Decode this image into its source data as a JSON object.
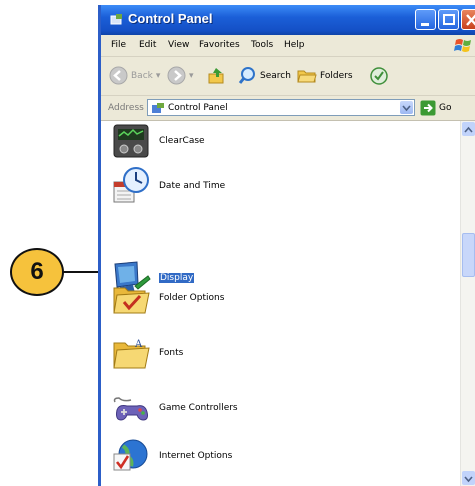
{
  "callout": {
    "number": "6"
  },
  "window": {
    "title": "Control Panel",
    "menu": [
      "File",
      "Edit",
      "View",
      "Favorites",
      "Tools",
      "Help"
    ],
    "toolbar": {
      "back_label": "Back",
      "search_label": "Search",
      "folders_label": "Folders"
    },
    "address": {
      "label": "Address",
      "value": "Control Panel",
      "go_label": "Go"
    }
  },
  "items": [
    {
      "label": "ClearCase",
      "icon": "clearcase-icon"
    },
    {
      "label": "Date and Time",
      "icon": "date-time-icon"
    },
    {
      "label": "Display",
      "icon": "display-icon",
      "selected": true
    },
    {
      "label": "Folder Options",
      "icon": "folder-options-icon"
    },
    {
      "label": "Fonts",
      "icon": "fonts-folder-icon"
    },
    {
      "label": "Game Controllers",
      "icon": "game-controller-icon"
    },
    {
      "label": "Internet Options",
      "icon": "internet-options-icon"
    }
  ],
  "colors": {
    "titlebar": "#1b5fd8",
    "selection": "#316ac5",
    "callout": "#f6c23c",
    "chrome": "#ece9d8"
  }
}
